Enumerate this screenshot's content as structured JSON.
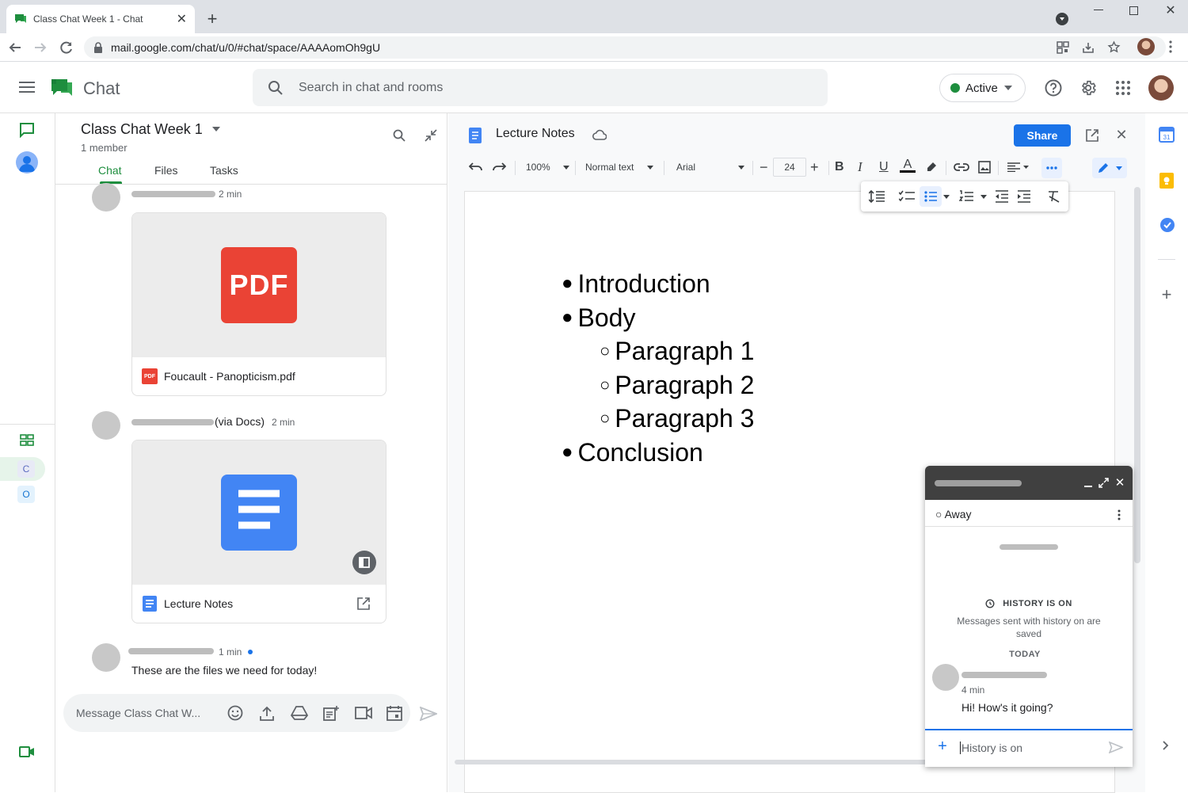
{
  "browser": {
    "tab_title": "Class Chat Week 1 - Chat",
    "url": "mail.google.com/chat/u/0/#chat/space/AAAAomOh9gU"
  },
  "app": {
    "name": "Chat",
    "search_placeholder": "Search in chat and rooms",
    "status_label": "Active",
    "status_color": "#1e8e3e"
  },
  "rail": {
    "space_letters": [
      "C",
      "O"
    ]
  },
  "space": {
    "title": "Class Chat Week 1",
    "members": "1 member",
    "tabs": [
      "Chat",
      "Files",
      "Tasks"
    ],
    "active_tab": "Chat",
    "messages": [
      {
        "time": "2 min",
        "attachment": {
          "type": "pdf",
          "badge": "PDF",
          "icon_label": "PDF",
          "name": "Foucault - Panopticism.pdf"
        }
      },
      {
        "via": "(via Docs)",
        "time": "2 min",
        "attachment": {
          "type": "doc",
          "name": "Lecture Notes"
        }
      },
      {
        "time": "1 min",
        "text": "These are the files we need for today!"
      }
    ],
    "compose_placeholder": "Message Class Chat W..."
  },
  "doc": {
    "title": "Lecture Notes",
    "share_label": "Share",
    "zoom": "100%",
    "style": "Normal text",
    "font": "Arial",
    "font_size": "24",
    "accent": "#1a73e8",
    "content": [
      {
        "level": 1,
        "bullet": "●",
        "text": "Introduction"
      },
      {
        "level": 1,
        "bullet": "●",
        "text": "Body"
      },
      {
        "level": 2,
        "bullet": "○",
        "text": "Paragraph 1"
      },
      {
        "level": 2,
        "bullet": "○",
        "text": "Paragraph 2"
      },
      {
        "level": 2,
        "bullet": "○",
        "text": "Paragraph 3"
      },
      {
        "level": 1,
        "bullet": "●",
        "text": "Conclusion"
      }
    ]
  },
  "popup": {
    "status": "○ Away",
    "history_title": "HISTORY IS ON",
    "history_desc": "Messages sent with history on are saved",
    "day": "TODAY",
    "msg_time": "4 min",
    "msg_text": "Hi! How's it going?",
    "input_placeholder": "History is on"
  }
}
